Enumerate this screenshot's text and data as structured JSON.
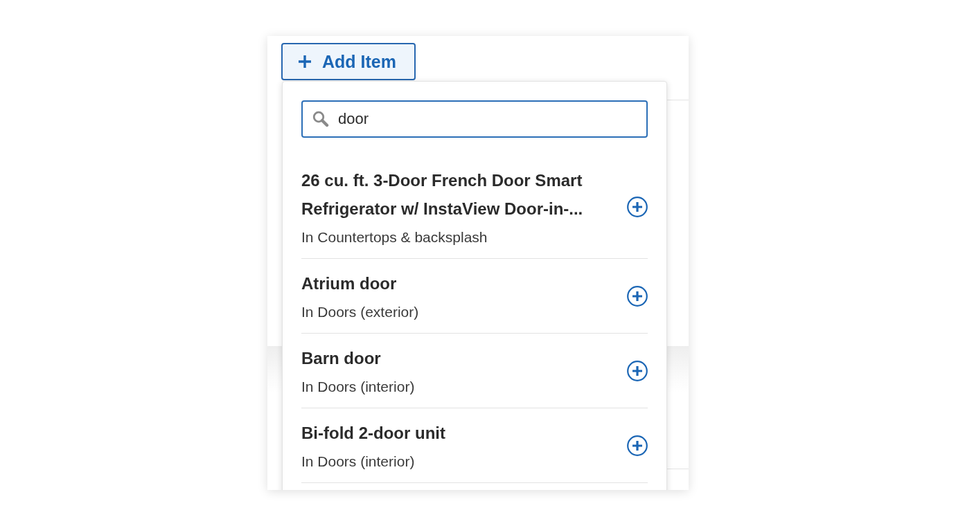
{
  "add_button": {
    "label": "Add Item",
    "expanded": true
  },
  "dropdown": {
    "search": {
      "value": "door"
    },
    "results": [
      {
        "title": "26 cu. ft. 3-Door French Door Smart Refrigerator w/ InstaView Door-in-...",
        "category": "In Countertops & backsplash"
      },
      {
        "title": "Atrium door",
        "category": "In Doors (exterior)"
      },
      {
        "title": "Barn door",
        "category": "In Doors (interior)"
      },
      {
        "title": "Bi-fold 2-door unit",
        "category": "In Doors (interior)"
      }
    ]
  }
}
